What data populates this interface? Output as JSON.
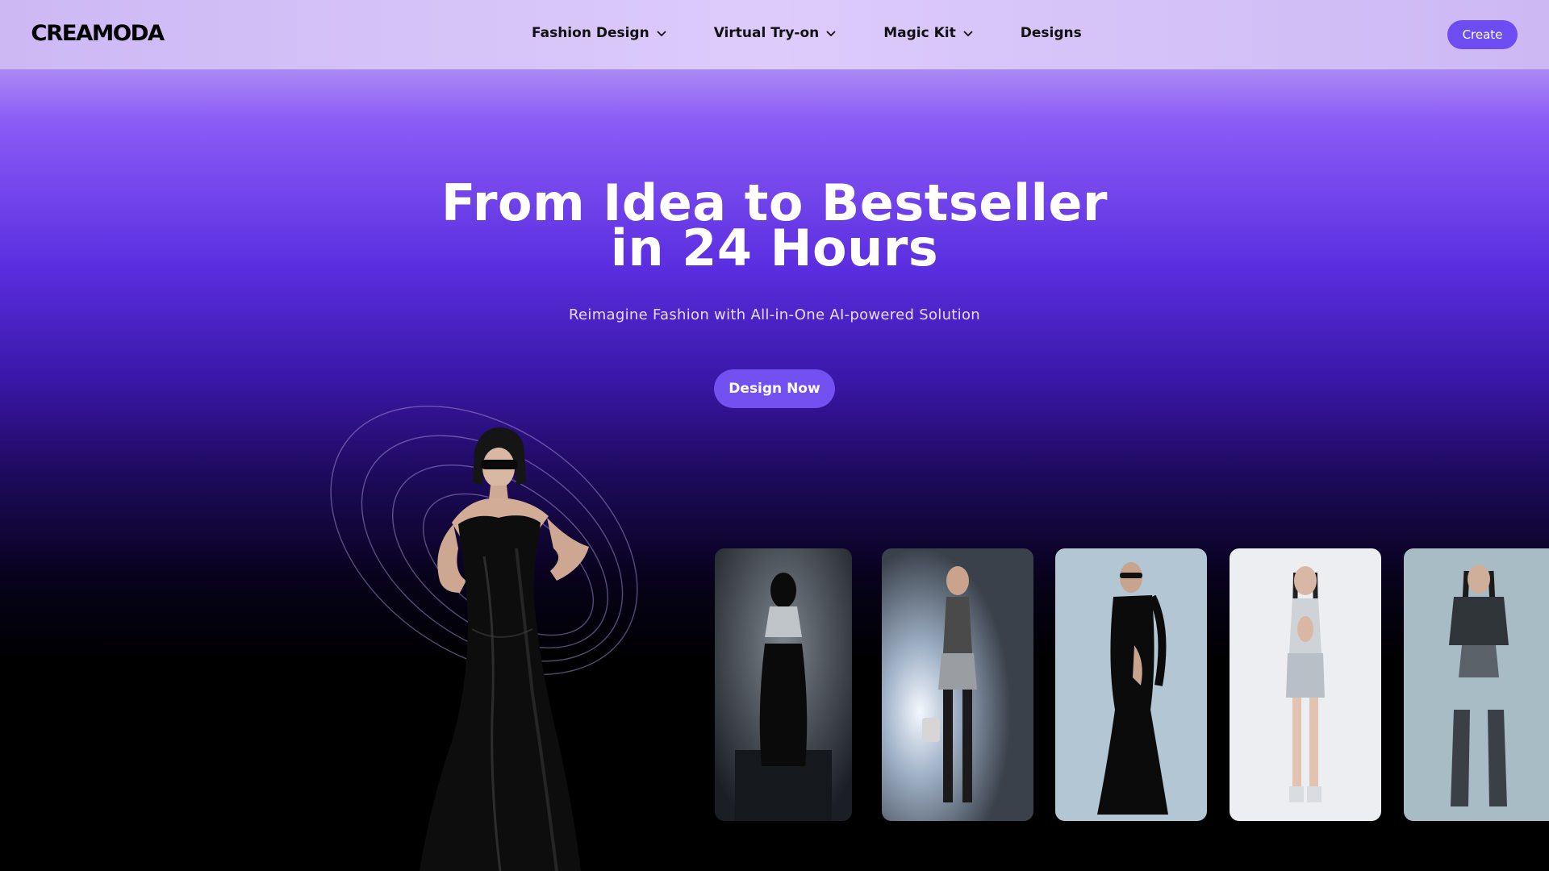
{
  "header": {
    "logo_text": "CREAMODA",
    "nav": [
      {
        "label": "Fashion Design",
        "has_dropdown": true
      },
      {
        "label": "Virtual Try-on",
        "has_dropdown": true
      },
      {
        "label": "Magic Kit",
        "has_dropdown": true
      },
      {
        "label": "Designs",
        "has_dropdown": false
      }
    ],
    "create_label": "Create"
  },
  "hero": {
    "title_line1": "From Idea to Bestseller",
    "title_line2": "in 24 Hours",
    "subtitle": "Reimagine Fashion with All-in-One AI-powered Solution",
    "cta_label": "Design Now"
  },
  "colors": {
    "accent": "#6d4df2",
    "header_bg": "#d4c2f8",
    "hero_purple": "#5b2ee0"
  },
  "gallery": [
    {
      "icon": "fashion-model-image",
      "bg": "#2a2e35"
    },
    {
      "icon": "fashion-model-image",
      "bg": "#3b4250"
    },
    {
      "icon": "fashion-model-image",
      "bg": "#b9c9d6"
    },
    {
      "icon": "fashion-model-image",
      "bg": "#eef0f3"
    },
    {
      "icon": "fashion-model-image",
      "bg": "#a9bec8"
    }
  ]
}
